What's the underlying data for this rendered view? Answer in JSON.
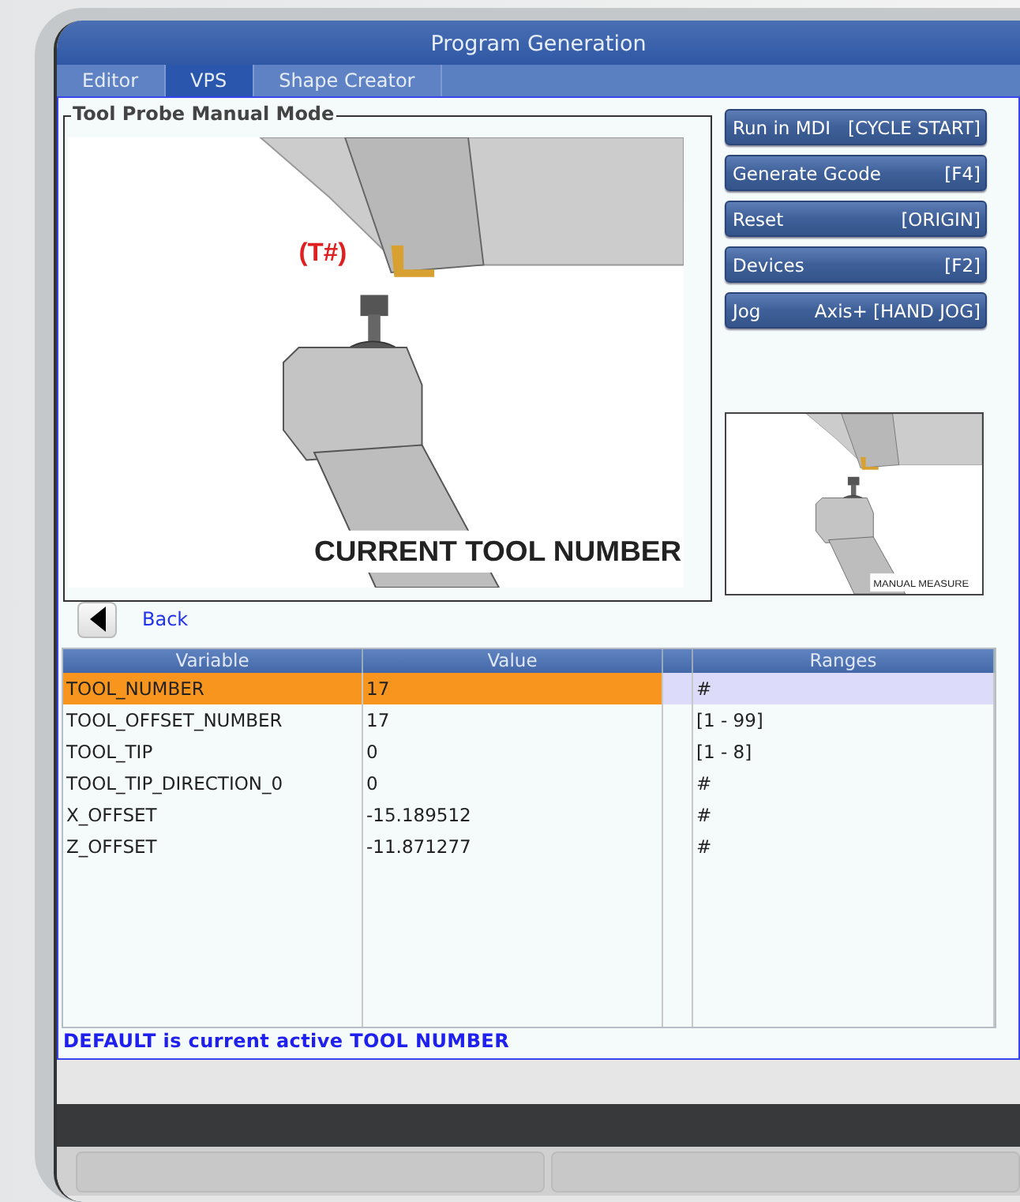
{
  "window": {
    "title": "Program Generation"
  },
  "tabs": [
    {
      "label": "Editor",
      "selected": false
    },
    {
      "label": "VPS",
      "selected": true
    },
    {
      "label": "Shape Creator",
      "selected": false
    }
  ],
  "panel": {
    "title": "Tool Probe Manual Mode",
    "image": {
      "tool_label": "(T#)",
      "caption": "CURRENT TOOL NUMBER"
    },
    "thumbnail": {
      "caption": "MANUAL MEASURE"
    }
  },
  "actions": [
    {
      "label": "Run in MDI",
      "key": "[CYCLE START]"
    },
    {
      "label": "Generate Gcode",
      "key": "[F4]"
    },
    {
      "label": "Reset",
      "key": "[ORIGIN]"
    },
    {
      "label": "Devices",
      "key": "[F2]"
    },
    {
      "label": "Jog",
      "key": "Axis+ [HAND JOG]"
    }
  ],
  "back": {
    "label": "Back"
  },
  "table": {
    "columns": [
      "Variable",
      "Value",
      "Ranges"
    ],
    "rows": [
      {
        "variable": "TOOL_NUMBER",
        "value": "17",
        "range": "#",
        "selected": true
      },
      {
        "variable": "TOOL_OFFSET_NUMBER",
        "value": "17",
        "range": "[1 - 99]",
        "selected": false
      },
      {
        "variable": "TOOL_TIP",
        "value": "0",
        "range": "[1 - 8]",
        "selected": false
      },
      {
        "variable": "TOOL_TIP_DIRECTION_0",
        "value": "0",
        "range": "#",
        "selected": false
      },
      {
        "variable": "X_OFFSET",
        "value": "-15.189512",
        "range": "#",
        "selected": false
      },
      {
        "variable": "Z_OFFSET",
        "value": "-11.871277",
        "range": "#",
        "selected": false
      }
    ]
  },
  "status": "DEFAULT is current active TOOL NUMBER"
}
